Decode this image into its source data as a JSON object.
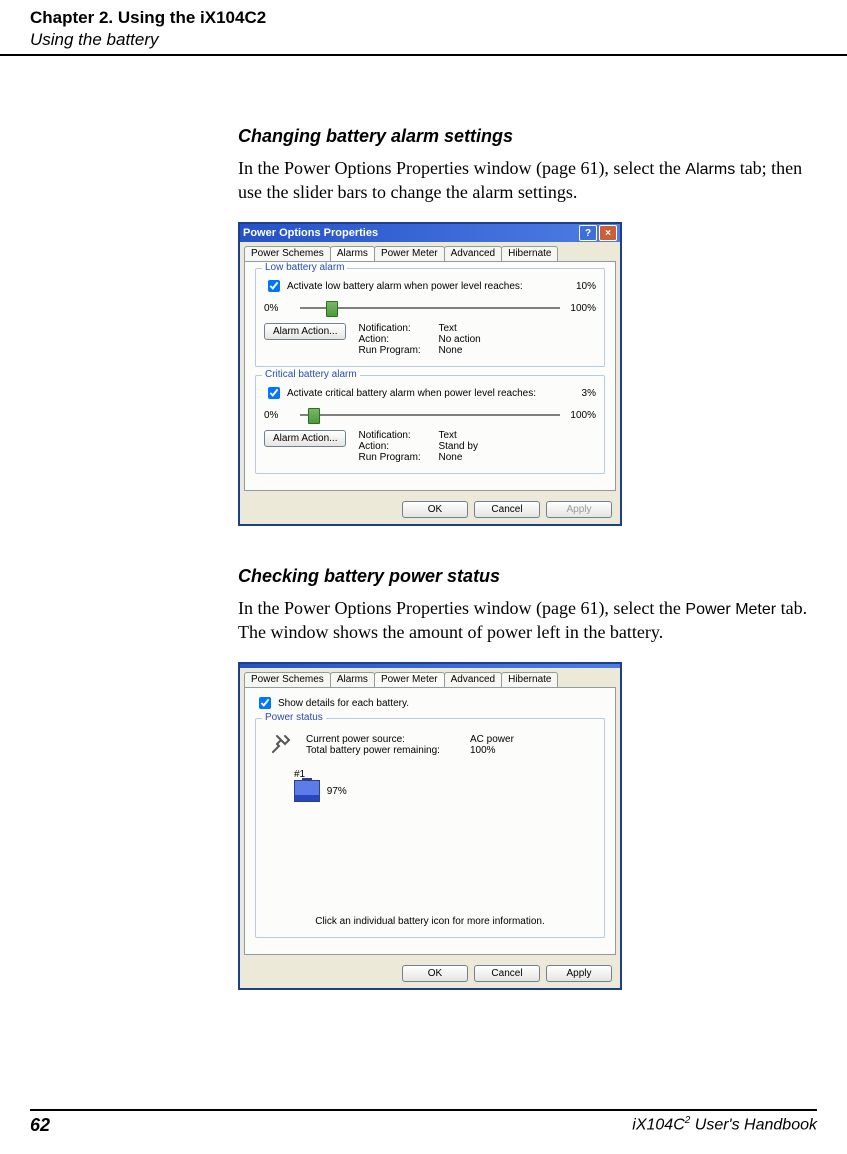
{
  "header": {
    "chapter": "Chapter 2. Using the iX104C2",
    "section": "Using the battery"
  },
  "section1": {
    "heading": "Changing battery alarm settings",
    "para_a": "In the Power Options Properties window (page 61), select the ",
    "para_tab_word": "Alarms",
    "para_b": " tab; then use the slider bars to change the alarm settings."
  },
  "dlg1": {
    "title": "Power Options Properties",
    "tabs": [
      "Power Schemes",
      "Alarms",
      "Power Meter",
      "Advanced",
      "Hibernate"
    ],
    "low_group": "Low battery alarm",
    "low_check": "Activate low battery alarm when power level reaches:",
    "low_value": "10%",
    "slider_min": "0%",
    "slider_max": "100%",
    "alarm_action_btn": "Alarm Action...",
    "kv_labels": {
      "notification": "Notification:",
      "action": "Action:",
      "run": "Run Program:"
    },
    "low_vals": {
      "notification": "Text",
      "action": "No action",
      "run": "None"
    },
    "crit_group": "Critical battery alarm",
    "crit_check": "Activate critical battery alarm when power level reaches:",
    "crit_value": "3%",
    "crit_vals": {
      "notification": "Text",
      "action": "Stand by",
      "run": "None"
    },
    "buttons": {
      "ok": "OK",
      "cancel": "Cancel",
      "apply": "Apply"
    }
  },
  "section2": {
    "heading": "Checking battery power status",
    "para_a": "In the Power Options Properties window (page 61), select the ",
    "para_tab_word": "Power Meter",
    "para_b": " tab. The window shows the amount of power left in the battery."
  },
  "dlg2": {
    "tabs": [
      "Power Schemes",
      "Alarms",
      "Power Meter",
      "Advanced",
      "Hibernate"
    ],
    "show_details": "Show details for each battery.",
    "group": "Power status",
    "src_label": "Current power source:",
    "src_val": "AC power",
    "rem_label": "Total battery power remaining:",
    "rem_val": "100%",
    "batt_num": "#1",
    "batt_pct": "97%",
    "hint": "Click an individual battery icon for more information.",
    "buttons": {
      "ok": "OK",
      "cancel": "Cancel",
      "apply": "Apply"
    }
  },
  "footer": {
    "page": "62",
    "book_prefix": "iX104C",
    "book_sup": "2",
    "book_suffix": " User's Handbook"
  }
}
